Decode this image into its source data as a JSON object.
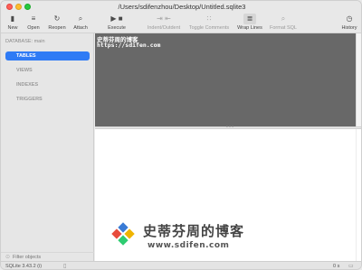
{
  "window": {
    "title": "/Users/sdifenzhou/Desktop/Untitled.sqlite3"
  },
  "toolbar": {
    "new": {
      "label": "New",
      "icon": "document-icon"
    },
    "open": {
      "label": "Open",
      "icon": "list-icon"
    },
    "reopen": {
      "label": "Reopen",
      "icon": "refresh-icon"
    },
    "attach": {
      "label": "Attach",
      "icon": "paperclip-icon"
    },
    "execute": {
      "label": "Execute",
      "icon": "play-icon"
    },
    "indent": {
      "label": "Indent/Outdent",
      "icon": "indent-icon"
    },
    "comments": {
      "label": "Toggle Comments",
      "icon": "comment-icon"
    },
    "wrap": {
      "label": "Wrap Lines",
      "icon": "wrap-icon"
    },
    "format": {
      "label": "Format SQL",
      "icon": "magnifier-icon"
    },
    "history": {
      "label": "History",
      "icon": "clock-icon"
    }
  },
  "sidebar": {
    "database_label": "DATABASE: main",
    "items": [
      {
        "label": "TABLES",
        "active": true
      },
      {
        "label": "VIEWS",
        "active": false
      },
      {
        "label": "INDEXES",
        "active": false
      },
      {
        "label": "TRIGGERS",
        "active": false
      }
    ],
    "filter_placeholder": "Filter objects"
  },
  "editor": {
    "lines": [
      "史蒂芬周的博客",
      "https://sdifen.com"
    ]
  },
  "watermark": {
    "title": "史蒂芬周的博客",
    "url": "www.sdifen.com"
  },
  "statusbar": {
    "version": "SQLite 3.43.2 (i)",
    "time": "0 s"
  },
  "colors": {
    "accent": "#2f7bf5",
    "editor_bg": "#686868"
  }
}
